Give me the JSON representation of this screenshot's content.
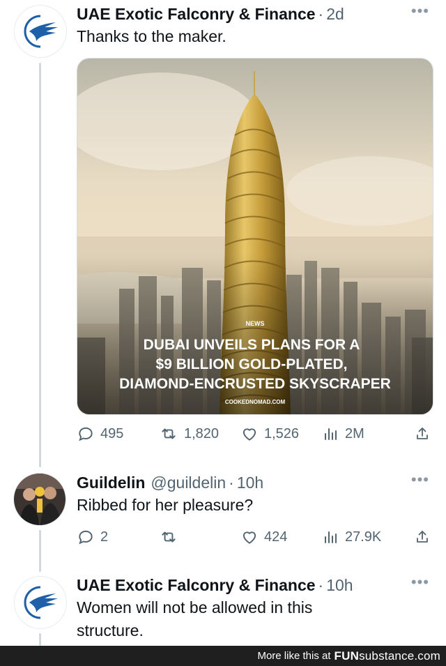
{
  "tweets": [
    {
      "name": "UAE Exotic Falconry & Finance",
      "time": "2d",
      "text": "Thanks to the maker.",
      "more": "•••",
      "image": {
        "tag": "NEWS",
        "headline_lines": [
          "DUBAI UNVEILS PLANS FOR A",
          "$9 BILLION GOLD-PLATED,",
          "DIAMOND-ENCRUSTED SKYSCRAPER"
        ],
        "credit": "COOKEDNOMAD.COM"
      },
      "actions": {
        "replies": "495",
        "retweets": "1,820",
        "likes": "1,526",
        "views": "2M"
      }
    },
    {
      "name": "Guildelin",
      "handle": "@guildelin",
      "time": "10h",
      "text": "Ribbed for her pleasure?",
      "more": "•••",
      "actions": {
        "replies": "2",
        "retweets": "",
        "likes": "424",
        "views": "27.9K"
      }
    },
    {
      "name": "UAE Exotic Falconry & Finance",
      "time": "10h",
      "text": "Women will not be allowed in this structure.",
      "more": "•••"
    }
  ],
  "separator": "·",
  "colors": {
    "text": "#0f1419",
    "muted": "#536471",
    "thread_line": "#cfd9de",
    "logo_blue": "#1d5fa8",
    "footer_bg": "#1f1f1f"
  },
  "icons": [
    "falcon-logo-icon",
    "reply-icon",
    "retweet-icon",
    "like-icon",
    "views-icon",
    "share-icon",
    "more-icon"
  ],
  "footer": {
    "text": "More like this at",
    "brand_main": "FUN",
    "brand_sub": "substance",
    "brand_tld": ".com"
  }
}
